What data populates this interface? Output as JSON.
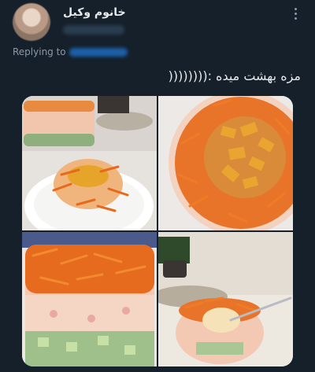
{
  "author": {
    "display_name": "خانوم وکیل"
  },
  "reply": {
    "label": "Replying to"
  },
  "tweet": {
    "text": "مزه بهشت میده :(((((((("
  },
  "icons": {
    "more": "more-vertical-icon"
  },
  "colors": {
    "background": "#15202b",
    "text": "#e7e9ea",
    "secondary": "#8b98a5",
    "link": "#1d9bf0"
  }
}
